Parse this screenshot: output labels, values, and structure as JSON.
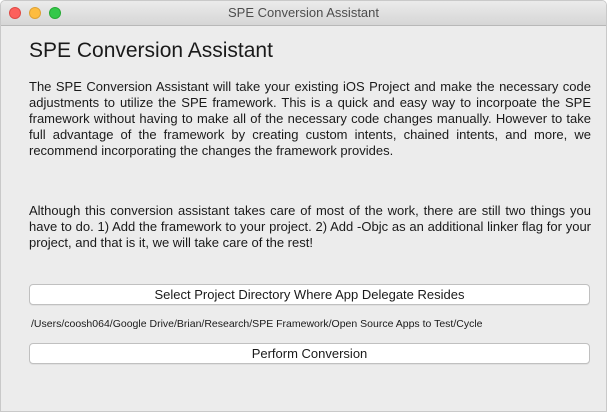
{
  "window": {
    "title": "SPE Conversion Assistant"
  },
  "main": {
    "heading": "SPE Conversion Assistant",
    "paragraph1": "The SPE Conversion Assistant will take your existing iOS Project and make the necessary code adjustments to utilize the SPE framework.  This is a quick and easy way to incorpoate the SPE framework without having to make all of the necessary code changes manually.  However to take full advantage of the framework by creating custom intents, chained intents, and more, we recommend incorporating the changes the framework provides.",
    "paragraph2": "Although this conversion assistant takes care of most of the work, there are still two things you have to do.  1) Add the framework to your project.  2) Add -Objc as an additional linker flag for your project, and that is it, we will take care of the rest!",
    "select_button_label": "Select Project Directory Where App Delegate Resides",
    "selected_path": "/Users/coosh064/Google Drive/Brian/Research/SPE Framework/Open Source Apps to Test/Cycle",
    "perform_button_label": "Perform Conversion"
  },
  "colors": {
    "close": "#fc605c",
    "minimize": "#fdbc40",
    "zoom": "#34c84a"
  }
}
